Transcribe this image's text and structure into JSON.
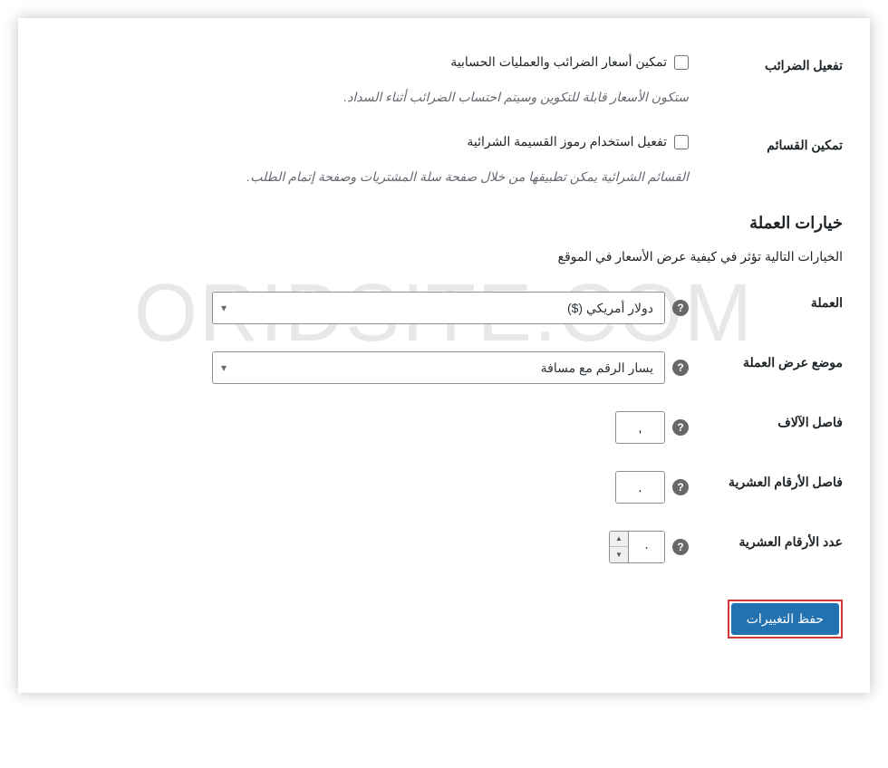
{
  "watermark": "ORIDSITE.COM",
  "rows": {
    "enable_taxes": {
      "label": "تفعيل الضرائب",
      "checkbox_label": "تمكين أسعار الضرائب والعمليات الحسابية",
      "description": "ستكون الأسعار قابلة للتكوين وسيتم احتساب الضرائب أثناء السداد."
    },
    "enable_coupons": {
      "label": "تمكين القسائم",
      "checkbox_label": "تفعيل استخدام رموز القسيمة الشرائية",
      "description": "القسائم الشرائية يمكن تطبيقها من خلال صفحة سلة المشتريات وصفحة إتمام الطلب."
    }
  },
  "currency_section": {
    "title": "خيارات العملة",
    "description": "الخيارات التالية تؤثر في كيفية عرض الأسعار في الموقع"
  },
  "currency": {
    "label": "العملة",
    "value": "دولار أمريكي ($)"
  },
  "currency_position": {
    "label": "موضع عرض العملة",
    "value": "يسار الرقم مع مسافة"
  },
  "thousand_sep": {
    "label": "فاصل الآلاف",
    "value": ","
  },
  "decimal_sep": {
    "label": "فاصل الأرقام العشرية",
    "value": "."
  },
  "num_decimals": {
    "label": "عدد الأرقام العشرية",
    "value": "٠"
  },
  "save_button": "حفظ التغييرات"
}
